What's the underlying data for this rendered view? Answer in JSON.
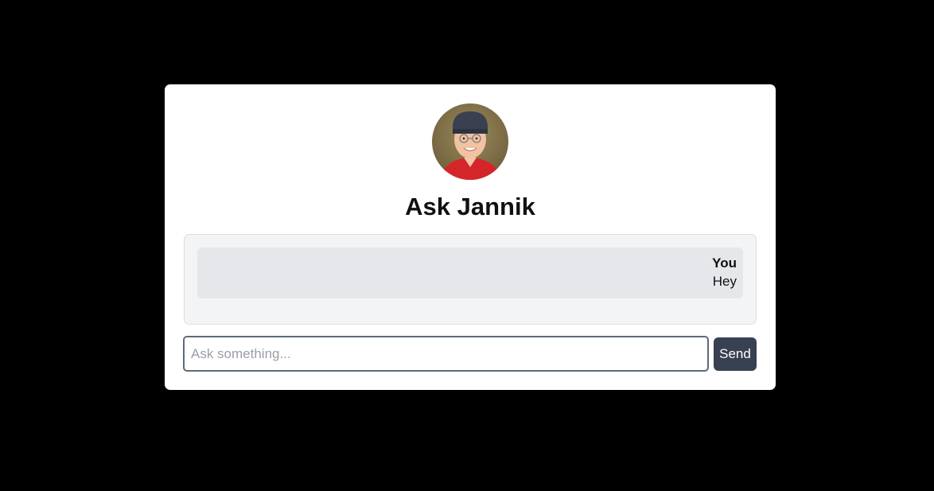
{
  "header": {
    "title": "Ask Jannik"
  },
  "chat": {
    "messages": [
      {
        "author": "You",
        "text": "Hey"
      }
    ]
  },
  "composer": {
    "placeholder": "Ask something...",
    "value": "",
    "send_label": "Send"
  },
  "colors": {
    "page_background": "#000000",
    "card_background": "#ffffff",
    "chat_background": "#f3f4f6",
    "message_background": "#e5e7eb",
    "button_background": "#374151",
    "input_border": "#5f6a78"
  }
}
